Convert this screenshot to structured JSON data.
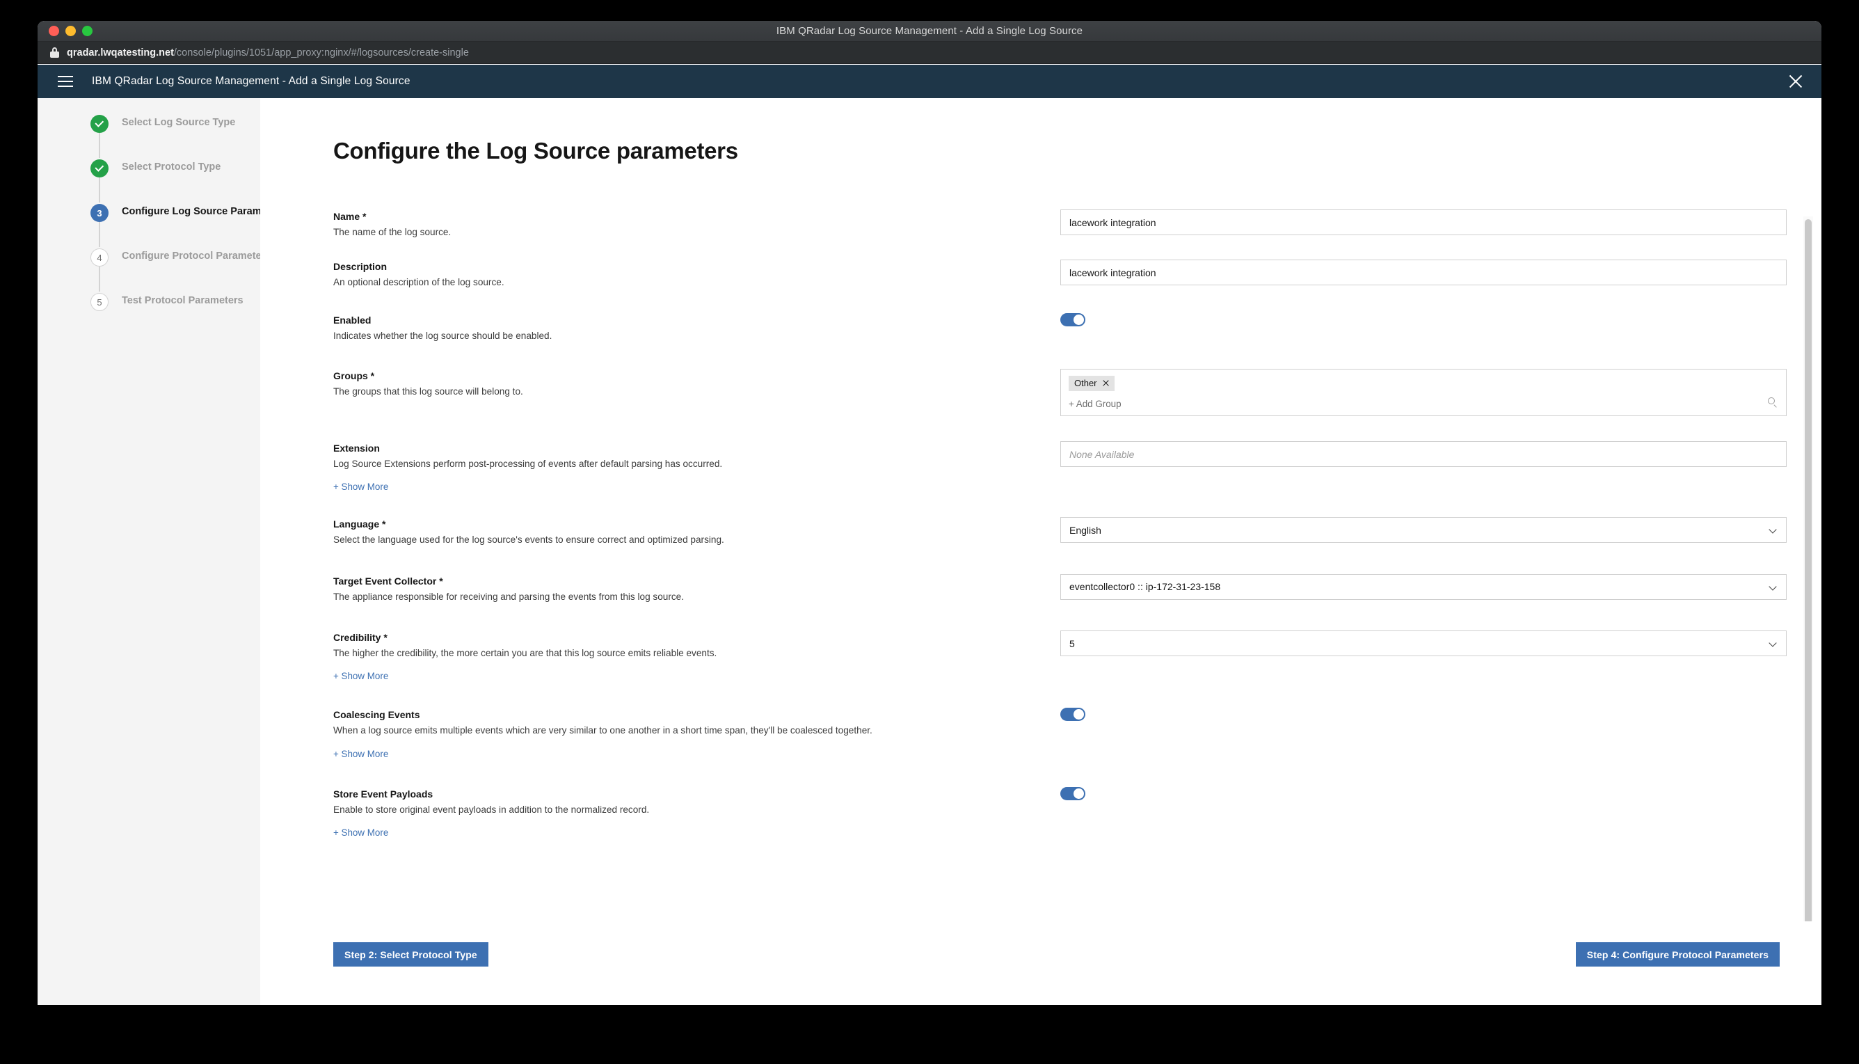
{
  "window": {
    "title": "IBM QRadar Log Source Management - Add a Single Log Source",
    "url_host": "qradar.lwqatesting.net",
    "url_path": "/console/plugins/1051/app_proxy:nginx/#/logsources/create-single"
  },
  "app_header": {
    "title": "IBM QRadar Log Source Management - Add a Single Log Source"
  },
  "steps": [
    {
      "number": "1",
      "label": "Select Log Source Type",
      "state": "done"
    },
    {
      "number": "2",
      "label": "Select Protocol Type",
      "state": "done"
    },
    {
      "number": "3",
      "label": "Configure Log Source Parameters",
      "state": "active"
    },
    {
      "number": "4",
      "label": "Configure Protocol Parameters",
      "state": "todo"
    },
    {
      "number": "5",
      "label": "Test Protocol Parameters",
      "state": "todo"
    }
  ],
  "main": {
    "page_title": "Configure the Log Source parameters",
    "fields": {
      "name": {
        "label": "Name *",
        "description": "The name of the log source.",
        "value": "lacework integration"
      },
      "description": {
        "label": "Description",
        "description": "An optional description of the log source.",
        "value": "lacework integration"
      },
      "enabled": {
        "label": "Enabled",
        "description": "Indicates whether the log source should be enabled.",
        "state": "on"
      },
      "groups": {
        "label": "Groups *",
        "description": "The groups that this log source will belong to.",
        "tags": [
          "Other"
        ],
        "add_label": "+ Add Group"
      },
      "extension": {
        "label": "Extension",
        "description": "Log Source Extensions perform post-processing of events after default parsing has occurred.",
        "placeholder": "None Available",
        "show_more": "+ Show More"
      },
      "language": {
        "label": "Language *",
        "description": "Select the language used for the log source's events to ensure correct and optimized parsing.",
        "value": "English"
      },
      "target_event_collector": {
        "label": "Target Event Collector *",
        "description": "The appliance responsible for receiving and parsing the events from this log source.",
        "value": "eventcollector0 :: ip-172-31-23-158"
      },
      "credibility": {
        "label": "Credibility *",
        "description": "The higher the credibility, the more certain you are that this log source emits reliable events.",
        "value": "5",
        "show_more": "+ Show More"
      },
      "coalescing_events": {
        "label": "Coalescing Events",
        "description": "When a log source emits multiple events which are very similar to one another in a short time span, they'll be coalesced together.",
        "state": "on",
        "show_more": "+ Show More"
      },
      "store_event_payloads": {
        "label": "Store Event Payloads",
        "description": "Enable to store original event payloads in addition to the normalized record.",
        "state": "on",
        "show_more": "+ Show More"
      }
    }
  },
  "footer": {
    "prev_label": "Step 2: Select Protocol Type",
    "next_label": "Step 4: Configure Protocol Parameters"
  },
  "colors": {
    "accent": "#3d70b2",
    "header_bg": "#1e3648",
    "done": "#24a148"
  }
}
